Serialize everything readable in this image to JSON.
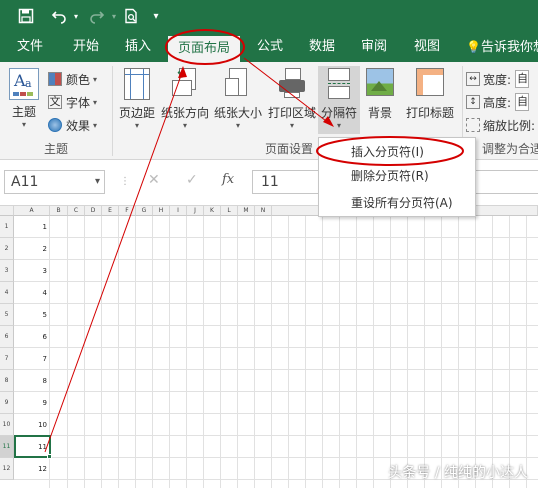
{
  "qat": {
    "save_icon": "save-icon",
    "undo_icon": "undo-icon",
    "redo_icon": "redo-icon",
    "print_preview_icon": "print-preview-icon",
    "customize_icon": "customize-qat-icon"
  },
  "tabs": [
    "文件",
    "开始",
    "插入",
    "页面布局",
    "公式",
    "数据",
    "审阅",
    "视图"
  ],
  "active_tab": "页面布局",
  "tell_me": "告诉我你想",
  "ribbon": {
    "themes_group": {
      "themes": "主题",
      "colors": "颜色",
      "fonts": "字体",
      "effects": "效果",
      "label": "主题"
    },
    "page_setup_group": {
      "margins": "页边距",
      "orientation": "纸张方向",
      "size": "纸张大小",
      "print_area": "打印区域",
      "breaks": "分隔符",
      "background": "背景",
      "print_titles": "打印标题",
      "label": "页面设置"
    },
    "scale_group": {
      "width": "宽度:",
      "height": "高度:",
      "scale": "缩放比例:",
      "width_value": "自",
      "height_value": "自",
      "label": "调整为合适"
    }
  },
  "breaks_menu": {
    "items": [
      "插入分页符(I)",
      "删除分页符(R)",
      "重设所有分页符(A)"
    ]
  },
  "formula_bar": {
    "name_box": "A11",
    "cancel": "✕",
    "enter": "✓",
    "fx": "fx",
    "value": "11"
  },
  "grid": {
    "columns": [
      "A",
      "B",
      "C",
      "D",
      "E",
      "F",
      "G",
      "H",
      "I",
      "J",
      "K",
      "L",
      "M",
      "N"
    ],
    "rows": [
      "1",
      "2",
      "3",
      "4",
      "5",
      "6",
      "7",
      "8",
      "9",
      "10",
      "11",
      "12"
    ],
    "col_a_values": [
      "1",
      "2",
      "3",
      "4",
      "5",
      "6",
      "7",
      "8",
      "9",
      "10",
      "11",
      "12"
    ],
    "selected_cell": "A11"
  },
  "watermark": "头条号 / 纯纯的小达人",
  "colors": {
    "excel_green": "#217346",
    "annotation_red": "#d40000"
  }
}
